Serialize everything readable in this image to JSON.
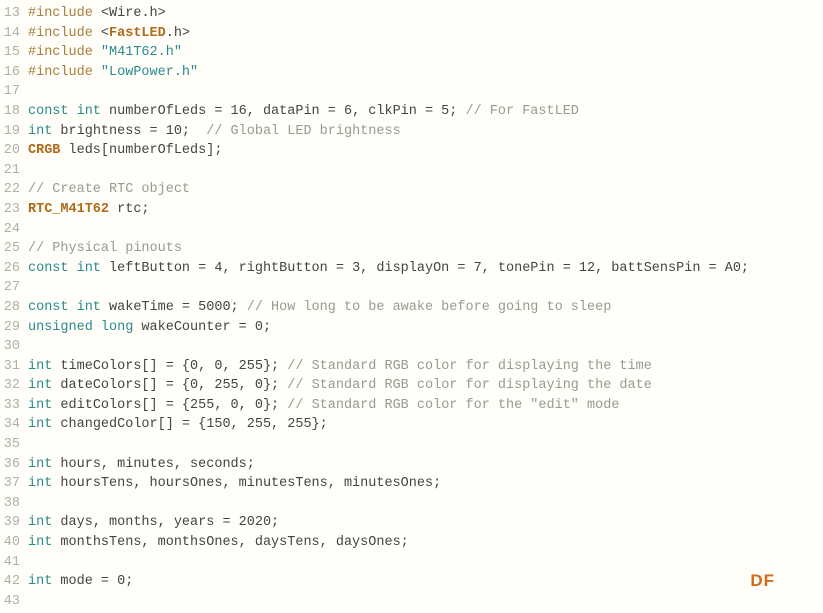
{
  "watermark": "DF",
  "lines": [
    {
      "num": "13",
      "tokens": [
        {
          "cls": "kw-pre",
          "t": "#include "
        },
        {
          "cls": "ident",
          "t": "<"
        },
        {
          "cls": "ident",
          "t": "Wire"
        },
        {
          "cls": "ident",
          "t": "."
        },
        {
          "cls": "ident",
          "t": "h"
        },
        {
          "cls": "ident",
          "t": ">"
        }
      ]
    },
    {
      "num": "14",
      "tokens": [
        {
          "cls": "kw-pre",
          "t": "#include "
        },
        {
          "cls": "ident",
          "t": "<"
        },
        {
          "cls": "type-bold",
          "t": "FastLED"
        },
        {
          "cls": "ident",
          "t": "."
        },
        {
          "cls": "ident",
          "t": "h"
        },
        {
          "cls": "ident",
          "t": ">"
        }
      ]
    },
    {
      "num": "15",
      "tokens": [
        {
          "cls": "kw-pre",
          "t": "#include "
        },
        {
          "cls": "str",
          "t": "\"M41T62.h\""
        }
      ]
    },
    {
      "num": "16",
      "tokens": [
        {
          "cls": "kw-pre",
          "t": "#include "
        },
        {
          "cls": "str",
          "t": "\"LowPower.h\""
        }
      ]
    },
    {
      "num": "17",
      "tokens": []
    },
    {
      "num": "18",
      "tokens": [
        {
          "cls": "kw-type",
          "t": "const int"
        },
        {
          "cls": "ident",
          "t": " numberOfLeds = 16, dataPin = 6, clkPin = 5; "
        },
        {
          "cls": "comment",
          "t": "// For FastLED"
        }
      ]
    },
    {
      "num": "19",
      "tokens": [
        {
          "cls": "kw-type",
          "t": "int"
        },
        {
          "cls": "ident",
          "t": " brightness = 10;  "
        },
        {
          "cls": "comment",
          "t": "// Global LED brightness"
        }
      ]
    },
    {
      "num": "20",
      "tokens": [
        {
          "cls": "type-bold",
          "t": "CRGB"
        },
        {
          "cls": "ident",
          "t": " leds[numberOfLeds];"
        }
      ]
    },
    {
      "num": "21",
      "tokens": []
    },
    {
      "num": "22",
      "tokens": [
        {
          "cls": "comment",
          "t": "// Create RTC object"
        }
      ]
    },
    {
      "num": "23",
      "tokens": [
        {
          "cls": "type-bold",
          "t": "RTC_M41T62"
        },
        {
          "cls": "ident",
          "t": " rtc;"
        }
      ]
    },
    {
      "num": "24",
      "tokens": []
    },
    {
      "num": "25",
      "tokens": [
        {
          "cls": "comment",
          "t": "// Physical pinouts"
        }
      ]
    },
    {
      "num": "26",
      "tokens": [
        {
          "cls": "kw-type",
          "t": "const int"
        },
        {
          "cls": "ident",
          "t": " leftButton = 4, rightButton = 3, displayOn = 7, tonePin = 12, battSensPin = A0;"
        }
      ]
    },
    {
      "num": "27",
      "tokens": []
    },
    {
      "num": "28",
      "tokens": [
        {
          "cls": "kw-type",
          "t": "const int"
        },
        {
          "cls": "ident",
          "t": " wakeTime = 5000; "
        },
        {
          "cls": "comment",
          "t": "// How long to be awake before going to sleep"
        }
      ]
    },
    {
      "num": "29",
      "tokens": [
        {
          "cls": "kw-type",
          "t": "unsigned long"
        },
        {
          "cls": "ident",
          "t": " wakeCounter = 0;"
        }
      ]
    },
    {
      "num": "30",
      "tokens": []
    },
    {
      "num": "31",
      "tokens": [
        {
          "cls": "kw-type",
          "t": "int"
        },
        {
          "cls": "ident",
          "t": " timeColors[] = {0, 0, 255}; "
        },
        {
          "cls": "comment",
          "t": "// Standard RGB color for displaying the time"
        }
      ]
    },
    {
      "num": "32",
      "tokens": [
        {
          "cls": "kw-type",
          "t": "int"
        },
        {
          "cls": "ident",
          "t": " dateColors[] = {0, 255, 0}; "
        },
        {
          "cls": "comment",
          "t": "// Standard RGB color for displaying the date"
        }
      ]
    },
    {
      "num": "33",
      "tokens": [
        {
          "cls": "kw-type",
          "t": "int"
        },
        {
          "cls": "ident",
          "t": " editColors[] = {255, 0, 0}; "
        },
        {
          "cls": "comment",
          "t": "// Standard RGB color for the \"edit\" mode"
        }
      ]
    },
    {
      "num": "34",
      "tokens": [
        {
          "cls": "kw-type",
          "t": "int"
        },
        {
          "cls": "ident",
          "t": " changedColor[] = {150, 255, 255};"
        }
      ]
    },
    {
      "num": "35",
      "tokens": []
    },
    {
      "num": "36",
      "tokens": [
        {
          "cls": "kw-type",
          "t": "int"
        },
        {
          "cls": "ident",
          "t": " hours, minutes, seconds;"
        }
      ]
    },
    {
      "num": "37",
      "tokens": [
        {
          "cls": "kw-type",
          "t": "int"
        },
        {
          "cls": "ident",
          "t": " hoursTens, hoursOnes, minutesTens, minutesOnes;"
        }
      ]
    },
    {
      "num": "38",
      "tokens": []
    },
    {
      "num": "39",
      "tokens": [
        {
          "cls": "kw-type",
          "t": "int"
        },
        {
          "cls": "ident",
          "t": " days, months, years = 2020;"
        }
      ]
    },
    {
      "num": "40",
      "tokens": [
        {
          "cls": "kw-type",
          "t": "int"
        },
        {
          "cls": "ident",
          "t": " monthsTens, monthsOnes, daysTens, daysOnes;"
        }
      ]
    },
    {
      "num": "41",
      "tokens": []
    },
    {
      "num": "42",
      "tokens": [
        {
          "cls": "kw-type",
          "t": "int"
        },
        {
          "cls": "ident",
          "t": " mode = 0;"
        }
      ]
    },
    {
      "num": "43",
      "tokens": []
    }
  ]
}
